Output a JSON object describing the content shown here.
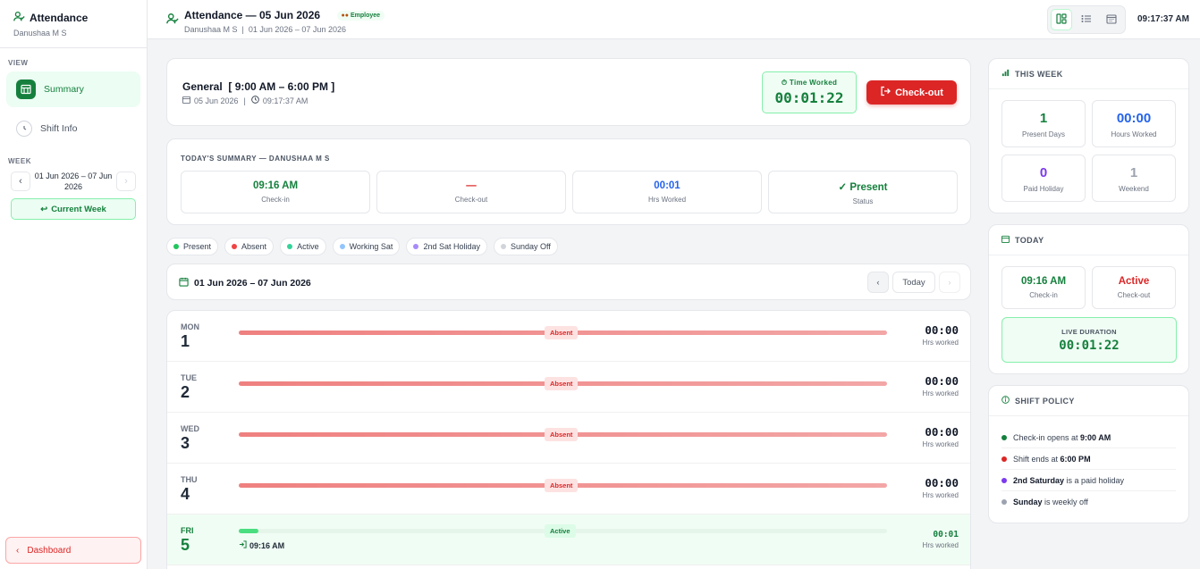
{
  "app": {
    "title": "Attendance",
    "user": "Danushaa M S"
  },
  "sidebar": {
    "view_label": "VIEW",
    "items": [
      {
        "label": "Summary",
        "icon": "calendar-grid-icon",
        "active": true
      },
      {
        "label": "Shift Info",
        "icon": "clock-icon",
        "active": false
      }
    ],
    "week_label": "WEEK",
    "week_range": "01 Jun 2026 – 07 Jun 2026",
    "current_week": "Current Week",
    "dashboard": "Dashboard"
  },
  "header": {
    "title": "Attendance — 05 Jun 2026",
    "subtitle": "Danushaa M S  |  01 Jun 2026 – 07 Jun 2026",
    "badge": "Employee",
    "time": "09:17:37 AM"
  },
  "shift": {
    "title": "General  [ 9:00 AM – 6:00 PM ]",
    "date": "05 Jun 2026",
    "time": "09:17:37 AM",
    "time_worked_label": "Time Worked",
    "time_worked": "00:01:22",
    "checkout_label": "Check-out"
  },
  "today_summary": {
    "heading": "TODAY'S SUMMARY — DANUSHAA M S",
    "boxes": [
      {
        "value": "09:16 AM",
        "label": "Check-in",
        "color": "#15803d"
      },
      {
        "value": "—",
        "label": "Check-out",
        "color": "#dc2626"
      },
      {
        "value": "00:01",
        "label": "Hrs Worked",
        "color": "#2563eb"
      },
      {
        "value": "✓ Present",
        "label": "Status",
        "color": "#15803d"
      }
    ]
  },
  "legend": [
    {
      "label": "Present",
      "color": "#22c55e"
    },
    {
      "label": "Absent",
      "color": "#ef4444"
    },
    {
      "label": "Active",
      "color": "#34d399"
    },
    {
      "label": "Working Sat",
      "color": "#93c5fd"
    },
    {
      "label": "2nd Sat Holiday",
      "color": "#a78bfa"
    },
    {
      "label": "Sunday Off",
      "color": "#d1d5db"
    }
  ],
  "week_view": {
    "range": "01 Jun 2026 – 07 Jun 2026",
    "today_btn": "Today",
    "hrs_label": "Hrs worked",
    "days": [
      {
        "day": "MON",
        "num": "1",
        "status": "Absent",
        "hours": "00:00"
      },
      {
        "day": "TUE",
        "num": "2",
        "status": "Absent",
        "hours": "00:00"
      },
      {
        "day": "WED",
        "num": "3",
        "status": "Absent",
        "hours": "00:00"
      },
      {
        "day": "THU",
        "num": "4",
        "status": "Absent",
        "hours": "00:00"
      },
      {
        "day": "FRI",
        "num": "5",
        "status": "Active",
        "hours": "00:01",
        "checkin": "09:16 AM",
        "progress": 0.03
      }
    ]
  },
  "this_week": {
    "heading": "THIS WEEK",
    "stats": [
      {
        "value": "1",
        "label": "Present Days",
        "color": "#15803d"
      },
      {
        "value": "00:00",
        "label": "Hours Worked",
        "color": "#2563eb"
      },
      {
        "value": "0",
        "label": "Paid Holiday",
        "color": "#7c3aed"
      },
      {
        "value": "1",
        "label": "Weekend",
        "color": "#9ca3af"
      }
    ]
  },
  "today_card": {
    "heading": "TODAY",
    "checkin": "09:16 AM",
    "checkin_label": "Check-in",
    "checkout": "Active",
    "checkout_label": "Check-out",
    "live_label": "LIVE DURATION",
    "live_value": "00:01:22"
  },
  "policy": {
    "heading": "SHIFT POLICY",
    "items": [
      {
        "pre": "Check-in opens at ",
        "bold": "9:00 AM",
        "post": "",
        "color": "#15803d"
      },
      {
        "pre": "Shift ends at ",
        "bold": "6:00 PM",
        "post": "",
        "color": "#dc2626"
      },
      {
        "pre": "",
        "bold": "2nd Saturday",
        "post": " is a paid holiday",
        "color": "#7c3aed"
      },
      {
        "pre": "",
        "bold": "Sunday",
        "post": " is weekly off",
        "color": "#9ca3af"
      }
    ]
  }
}
